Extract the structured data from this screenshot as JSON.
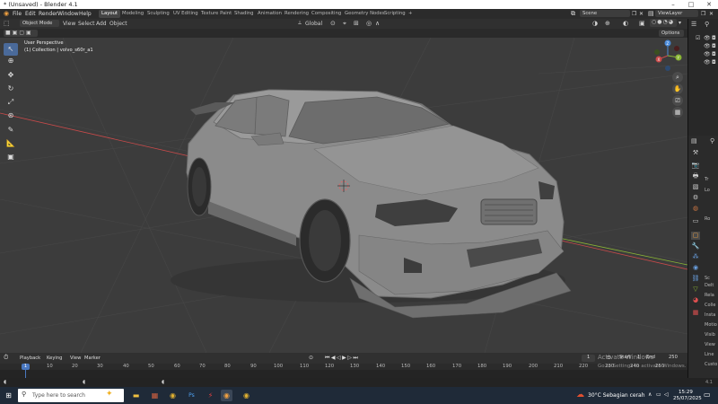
{
  "window": {
    "title": "* (Unsaved) - Blender 4.1",
    "minimize": "–",
    "maximize": "□",
    "close": "✕"
  },
  "menu": [
    "File",
    "Edit",
    "Render",
    "Window",
    "Help"
  ],
  "workspaces": [
    "Layout",
    "Modeling",
    "Sculpting",
    "UV Editing",
    "Texture Paint",
    "Shading",
    "Animation",
    "Rendering",
    "Compositing",
    "Geometry Nodes",
    "Scripting"
  ],
  "workspace_add": "+",
  "scene": {
    "label": "Scene",
    "view_layer": "ViewLayer"
  },
  "viewport_header": {
    "mode": "Object Mode",
    "menus": [
      "View",
      "Select",
      "Add",
      "Object"
    ],
    "orientation": "Global",
    "options": "Options"
  },
  "viewport": {
    "perspective": "User Perspective",
    "collection": "(1) Collection | volvo_s60r_a1",
    "gizmo": {
      "x": "X",
      "y": "Y",
      "z": "Z"
    }
  },
  "outliner_rows": [
    "",
    "",
    "",
    ""
  ],
  "properties_labels": [
    "Tr",
    "Lo",
    "",
    "",
    "",
    "Ro",
    "",
    "",
    "",
    "",
    "",
    "",
    "",
    "Sc",
    "",
    "",
    "Delt",
    "Rela",
    "Colle",
    "Insta",
    "Motio",
    "Visib",
    "View",
    "Line",
    "Custo"
  ],
  "timeline": {
    "menus": [
      "Playback",
      "Keying",
      "View",
      "Marker"
    ],
    "current_frame": "1",
    "start_label": "Start",
    "start": "1",
    "end_label": "End",
    "end": "250",
    "ticks": [
      "10",
      "20",
      "30",
      "40",
      "50",
      "60",
      "70",
      "80",
      "90",
      "100",
      "110",
      "120",
      "130",
      "140",
      "150",
      "160",
      "170",
      "180",
      "190",
      "200",
      "210",
      "220",
      "230",
      "240",
      "250"
    ],
    "playhead": "1"
  },
  "status": {
    "version": "4.1"
  },
  "watermark": {
    "line1": "Activate Windows",
    "line2": "Go to Settings to activate Windows."
  },
  "taskbar": {
    "search_placeholder": "Type here to search",
    "weather": "30°C  Sebagian cerah",
    "time": "15:29",
    "date": "25/07/2025"
  },
  "colors": {
    "accent": "#4a6a9a",
    "viewport_bg": "#3c3c3c",
    "car_body": "#8e8e8e",
    "x_axis": "#c94a4a",
    "y_axis": "#8ab635"
  }
}
